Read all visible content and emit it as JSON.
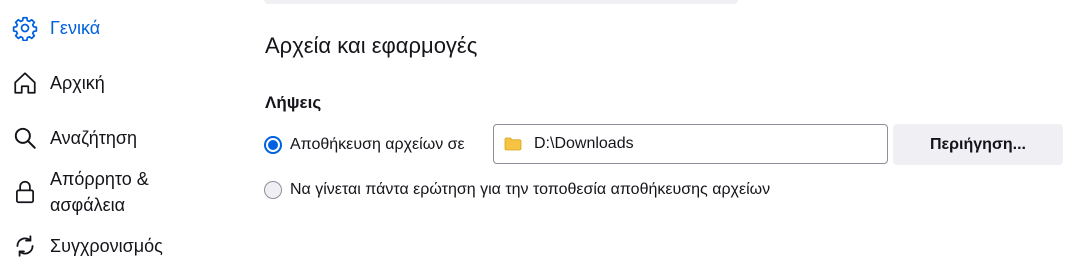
{
  "sidebar": {
    "items": [
      {
        "label": "Γενικά",
        "icon": "gear-icon",
        "active": true
      },
      {
        "label": "Αρχική",
        "icon": "home-icon",
        "active": false
      },
      {
        "label": "Αναζήτηση",
        "icon": "search-icon",
        "active": false
      },
      {
        "label": "Απόρρητο & ασφάλεια",
        "icon": "lock-icon",
        "active": false
      },
      {
        "label": "Συγχρονισμός",
        "icon": "sync-icon",
        "active": false
      }
    ]
  },
  "main": {
    "section_title": "Αρχεία και εφαρμογές",
    "downloads": {
      "title": "Λήψεις",
      "save_option_label": "Αποθήκευση αρχείων σε",
      "save_option_selected": true,
      "path_value": "D:\\Downloads",
      "browse_label": "Περιήγηση...",
      "ask_option_label": "Να γίνεται πάντα ερώτηση για την τοποθεσία αποθήκευσης αρχείων",
      "ask_option_selected": false
    }
  },
  "colors": {
    "accent": "#0061e0",
    "button_bg": "#f0f0f4",
    "folder": "#f6c343"
  }
}
